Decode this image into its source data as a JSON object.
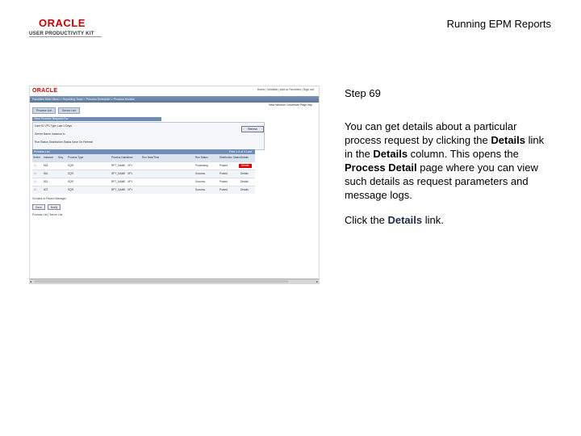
{
  "header": {
    "logo_brand": "ORACLE",
    "logo_subtitle": "USER PRODUCTIVITY KIT",
    "title": "Running EPM Reports"
  },
  "screenshot": {
    "app_logo": "ORACLE",
    "top_links": "Home  |  Worklist  |  Add to Favorites  |  Sign out",
    "nav_items": "Favorites    Main Menu  >  Reporting Tools  >  Process Scheduler  >  Process Monitor",
    "tabs": [
      "Process List",
      "Server List"
    ],
    "page_links": "New Window   Customize Page   http",
    "filter_title": "View Process Request For",
    "filter_rows": [
      "User ID  VP1   Type   Last   1   Days",
      "Server   Name   Instance   to",
      "Run Status   Distribution Status   Save On Refresh"
    ],
    "refresh_label": "Refresh",
    "grid_title": "Process List",
    "grid_pager": "First  1-4 of 4  Last",
    "columns": [
      "Select",
      "Instance",
      "Seq.",
      "Process Type",
      "Process Name",
      "User",
      "Run Date/Time",
      "Run Status",
      "Distribution Status",
      "Details"
    ],
    "rows": [
      [
        "818",
        "SQR",
        "RPT_NAME",
        "VP1",
        "Processing",
        "Posted",
        "Details"
      ],
      [
        "816",
        "SQR",
        "RPT_NAME",
        "VP1",
        "Success",
        "Posted",
        "Details"
      ],
      [
        "815",
        "SQR",
        "RPT_NAME",
        "VP1",
        "Success",
        "Posted",
        "Details"
      ],
      [
        "807",
        "SQR",
        "RPT_NAME",
        "VP1",
        "Success",
        "Posted",
        "Details"
      ]
    ],
    "bottom_link": "Go back to Report Manager",
    "save_label": "Save",
    "notify_label": "Notify",
    "bottom_links2": "Process List | Server List"
  },
  "instructions": {
    "step": "Step 69",
    "p1": "You can get details about a particular process request by clicking the ",
    "p1_b1": "Details",
    "p2": " link in the ",
    "p2_b2": "Details",
    "p3": " column. This opens the ",
    "p3_b3": "Process Detail",
    "p4": " page where you can view such details as request parameters and message logs.",
    "action_pre": "Click the ",
    "action_b": "Details",
    "action_post": " link."
  },
  "colors": {
    "brand_red": "#cc0000",
    "nav_blue": "#5b7599",
    "highlight_red": "#e00000"
  }
}
